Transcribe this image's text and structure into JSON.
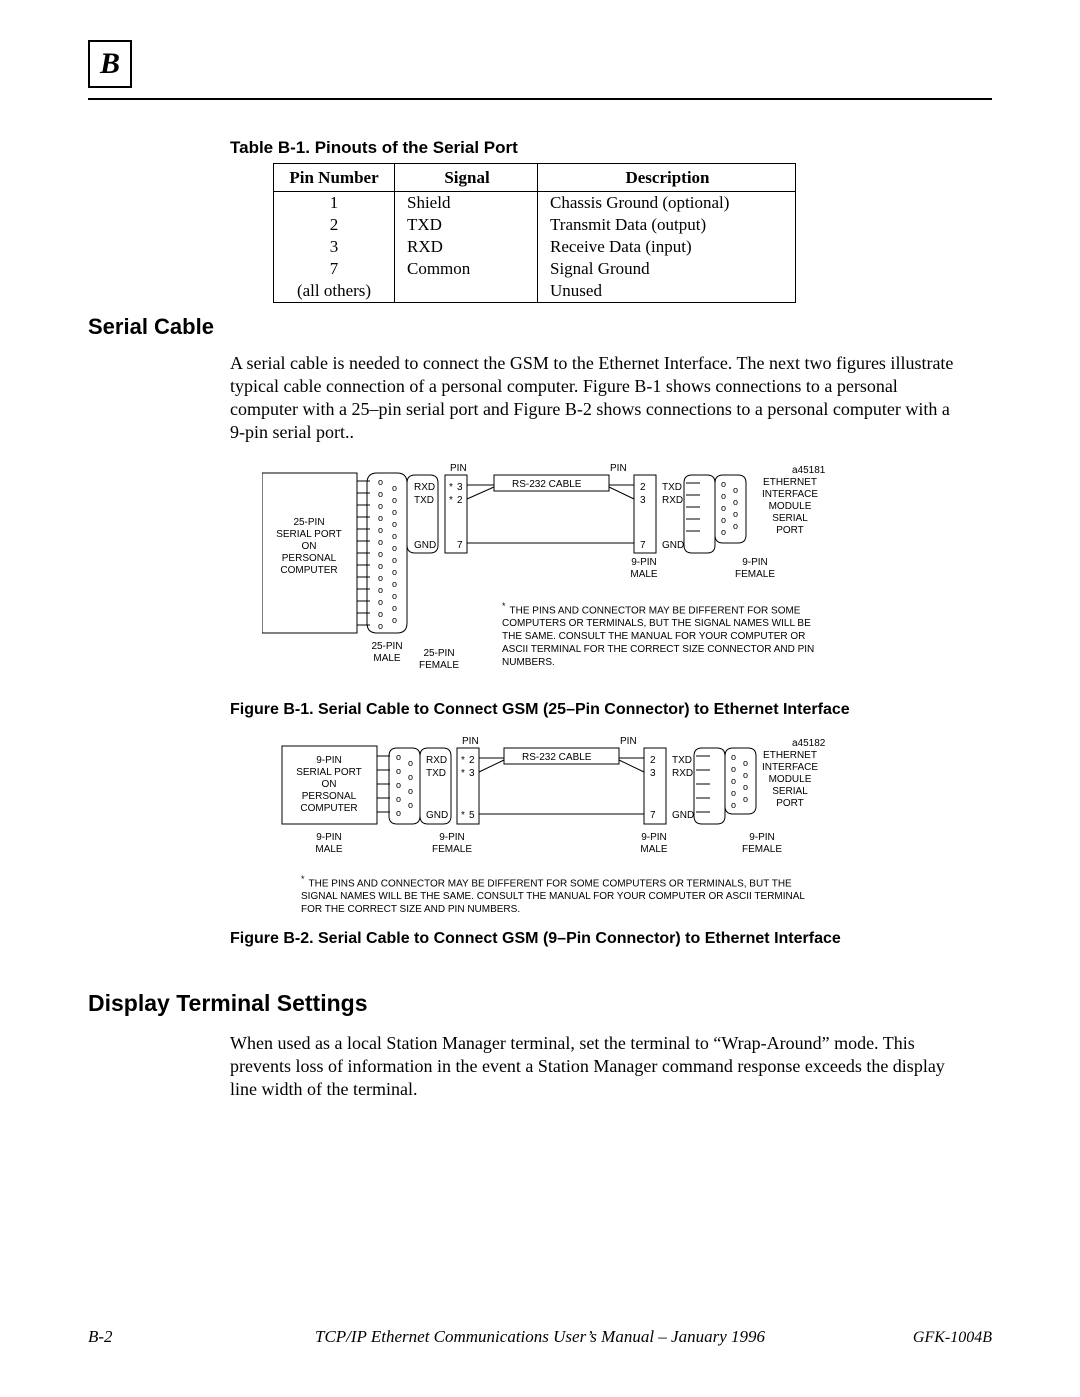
{
  "header": {
    "appendix_letter": "B"
  },
  "table": {
    "caption": "Table B-1.  Pinouts of the Serial Port",
    "columns": [
      "Pin Number",
      "Signal",
      "Description"
    ],
    "rows": [
      {
        "pin": "1",
        "signal": "Shield",
        "desc": "Chassis Ground (optional)"
      },
      {
        "pin": "2",
        "signal": "TXD",
        "desc": "Transmit Data (output)"
      },
      {
        "pin": "3",
        "signal": "RXD",
        "desc": "Receive Data (input)"
      },
      {
        "pin": "7",
        "signal": "Common",
        "desc": "Signal Ground"
      },
      {
        "pin": "(all others)",
        "signal": "",
        "desc": "Unused"
      }
    ]
  },
  "sections": {
    "serial_cable": {
      "heading": "Serial Cable",
      "para": "A serial cable is needed to connect the GSM to the Ethernet Interface.  The next two figures illustrate typical cable connection of a personal computer.   Figure B-1 shows connections to a personal computer with a 25–pin serial port and Figure B-2 shows connections to a personal computer with a 9-pin serial port.."
    },
    "display_terminal": {
      "heading": "Display Terminal Settings",
      "para": "When used as a local Station Manager terminal, set the terminal to “Wrap-Around” mode.  This prevents loss of information in the event a Station Manager command response exceeds the display line width of the terminal."
    }
  },
  "figures": {
    "fig1": {
      "caption": "Figure B-1.   Serial Cable to Connect GSM (25–Pin Connector) to Ethernet Interface",
      "left_label_lines": [
        "25-PIN",
        "SERIAL PORT",
        "ON",
        "PERSONAL",
        "COMPUTER"
      ],
      "right_label_lines": [
        "ETHERNET",
        "INTERFACE",
        "MODULE",
        "SERIAL",
        "PORT"
      ],
      "cable_label": "RS-232 CABLE",
      "pin_label": "PIN",
      "code": "a45181",
      "left_pins": [
        {
          "name": "RXD",
          "num": "3"
        },
        {
          "name": "TXD",
          "num": "2"
        },
        {
          "name": "GND",
          "num": "7"
        }
      ],
      "right_pins": [
        {
          "num": "2",
          "name": "TXD"
        },
        {
          "num": "3",
          "name": "RXD"
        },
        {
          "num": "7",
          "name": "GND"
        }
      ],
      "conn_labels": {
        "far_left": "25-PIN\nMALE",
        "mid_left": "25-PIN\nFEMALE",
        "mid_right": "9-PIN\nMALE",
        "far_right": "9-PIN\nFEMALE"
      },
      "footnote": "THE PINS AND CONNECTOR MAY BE DIFFERENT FOR SOME COMPUTERS OR TERMINALS, BUT THE SIGNAL NAMES WILL BE THE SAME. CONSULT THE MANUAL FOR YOUR COMPUTER OR ASCII TERMINAL FOR THE CORRECT SIZE CONNECTOR AND PIN NUMBERS."
    },
    "fig2": {
      "caption": "Figure B-2.   Serial Cable to Connect GSM (9–Pin Connector) to Ethernet Interface",
      "left_label_lines": [
        "9-PIN",
        "SERIAL PORT",
        "ON",
        "PERSONAL",
        "COMPUTER"
      ],
      "right_label_lines": [
        "ETHERNET",
        "INTERFACE",
        "MODULE",
        "SERIAL",
        "PORT"
      ],
      "cable_label": "RS-232 CABLE",
      "pin_label": "PIN",
      "code": "a45182",
      "left_pins": [
        {
          "name": "RXD",
          "num": "2"
        },
        {
          "name": "TXD",
          "num": "3"
        },
        {
          "name": "GND",
          "num": "5"
        }
      ],
      "right_pins": [
        {
          "num": "2",
          "name": "TXD"
        },
        {
          "num": "3",
          "name": "RXD"
        },
        {
          "num": "7",
          "name": "GND"
        }
      ],
      "conn_labels": {
        "far_left": "9-PIN\nMALE",
        "mid_left": "9-PIN\nFEMALE",
        "mid_right": "9-PIN\nMALE",
        "far_right": "9-PIN\nFEMALE"
      },
      "footnote": "THE PINS AND CONNECTOR MAY BE DIFFERENT FOR SOME COMPUTERS OR TERMINALS, BUT THE SIGNAL NAMES WILL BE THE SAME. CONSULT THE MANUAL FOR YOUR COMPUTER OR ASCII TERMINAL FOR THE CORRECT SIZE AND PIN NUMBERS."
    }
  },
  "footer": {
    "left": "B-2",
    "center": "TCP/IP Ethernet Communications User’s Manual – January 1996",
    "right": "GFK-1004B"
  }
}
